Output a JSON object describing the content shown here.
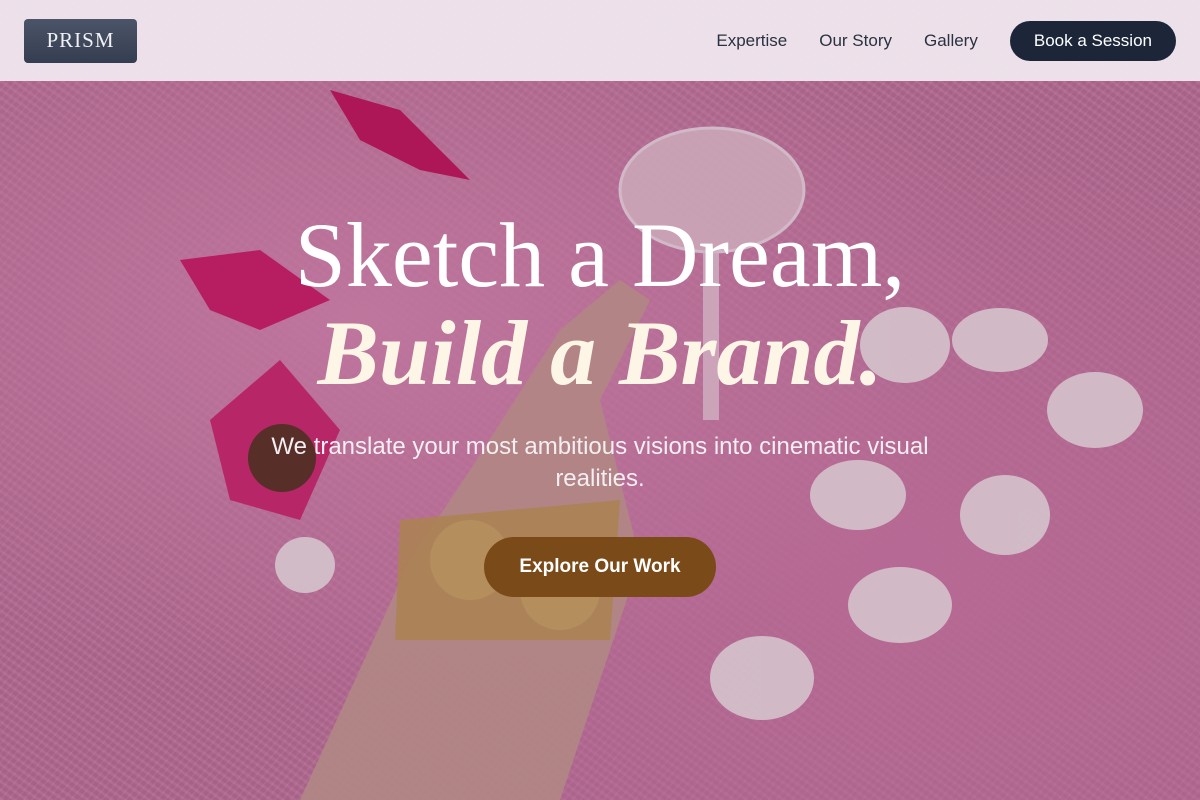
{
  "brand": {
    "logo_text": "PRISM"
  },
  "nav": {
    "links": [
      "Expertise",
      "Our Story",
      "Gallery"
    ],
    "cta_label": "Book a Session"
  },
  "hero": {
    "headline_line1": "Sketch a Dream,",
    "headline_line2": "Build a Brand.",
    "subtitle": "We translate your most ambitious visions into cinematic visual realities.",
    "cta_label": "Explore Our Work"
  },
  "colors": {
    "nav_background": "#EEE4EC",
    "logo_background": "#3F475B",
    "nav_cta_background": "#1C2638",
    "hero_cta_background": "#7A4A19",
    "hero_tint": "#C97AA3"
  }
}
